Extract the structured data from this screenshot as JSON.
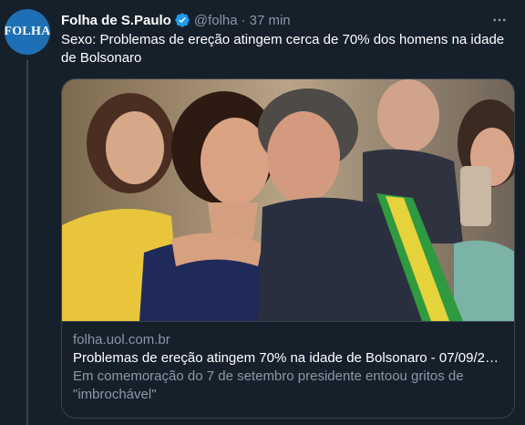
{
  "tweet": {
    "author": {
      "display_name": "Folha de S.Paulo",
      "handle": "@folha",
      "avatar_text": "FOLHA",
      "verified": true
    },
    "separator": "·",
    "time": "37 min",
    "text": "Sexo: Problemas de ereção atingem cerca de 70% dos homens na idade de Bolsonaro",
    "more_icon": "more-horizontal-icon",
    "card": {
      "domain": "folha.uol.com.br",
      "title": "Problemas de ereção atingem 70% na idade de Bolsonaro - 07/09/20…",
      "description": "Em comemoração do 7 de setembro presidente entoou gritos de \"imbrochável\""
    }
  },
  "colors": {
    "background": "#15202b",
    "border": "#38444d",
    "secondary_text": "#8b98a5",
    "verified": "#1d9bf0",
    "avatar_bg": "#1e6fb3"
  }
}
